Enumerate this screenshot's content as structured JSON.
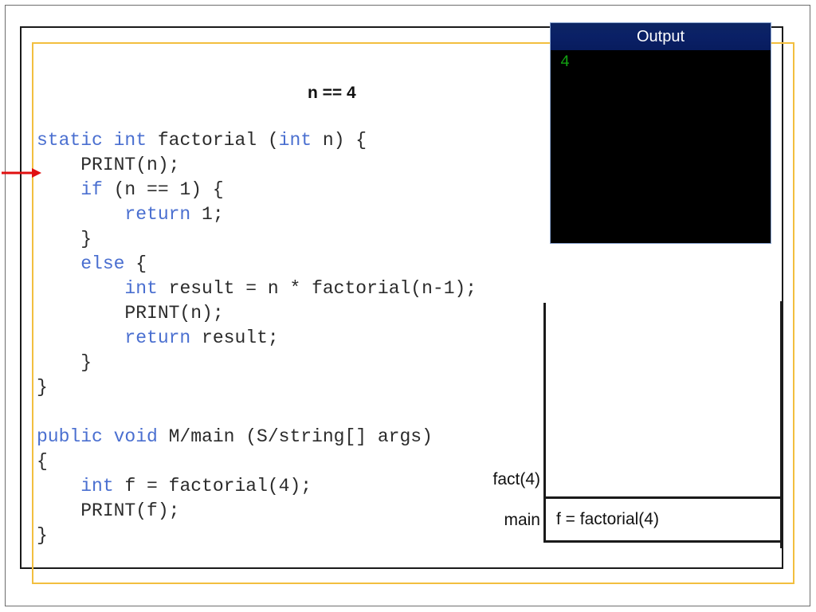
{
  "slide": {
    "title_annotation": "n == 4"
  },
  "code": {
    "lines": [
      [
        {
          "t": "static int",
          "c": "kw"
        },
        {
          "t": " factorial (",
          "c": ""
        },
        {
          "t": "int",
          "c": "kw"
        },
        {
          "t": " n) {",
          "c": ""
        }
      ],
      [
        {
          "t": "    PRINT(n);",
          "c": ""
        }
      ],
      [
        {
          "t": "    ",
          "c": ""
        },
        {
          "t": "if",
          "c": "kw"
        },
        {
          "t": " (n == 1) {",
          "c": ""
        }
      ],
      [
        {
          "t": "        ",
          "c": ""
        },
        {
          "t": "return",
          "c": "kw"
        },
        {
          "t": " 1;",
          "c": ""
        }
      ],
      [
        {
          "t": "    }",
          "c": ""
        }
      ],
      [
        {
          "t": "    ",
          "c": ""
        },
        {
          "t": "else",
          "c": "kw"
        },
        {
          "t": " {",
          "c": ""
        }
      ],
      [
        {
          "t": "        ",
          "c": ""
        },
        {
          "t": "int",
          "c": "kw"
        },
        {
          "t": " result = n * factorial(n-1);",
          "c": ""
        }
      ],
      [
        {
          "t": "        PRINT(n);",
          "c": ""
        }
      ],
      [
        {
          "t": "        ",
          "c": ""
        },
        {
          "t": "return",
          "c": "kw"
        },
        {
          "t": " result;",
          "c": ""
        }
      ],
      [
        {
          "t": "    }",
          "c": ""
        }
      ],
      [
        {
          "t": "}",
          "c": ""
        }
      ],
      [
        {
          "t": "",
          "c": ""
        }
      ],
      [
        {
          "t": "public void",
          "c": "kw"
        },
        {
          "t": " M/main (S/string[] args)",
          "c": ""
        }
      ],
      [
        {
          "t": "{",
          "c": ""
        }
      ],
      [
        {
          "t": "    ",
          "c": ""
        },
        {
          "t": "int",
          "c": "kw"
        },
        {
          "t": " f = factorial(4);",
          "c": ""
        }
      ],
      [
        {
          "t": "    PRINT(f);",
          "c": ""
        }
      ],
      [
        {
          "t": "}",
          "c": ""
        }
      ]
    ]
  },
  "output_window": {
    "title": "Output",
    "lines": [
      "4"
    ],
    "title_bar_color": "#0a2066",
    "body_color": "#000000",
    "text_color": "#12a012"
  },
  "call_stack": {
    "frames": [
      {
        "label": "fact(4)",
        "content": ""
      },
      {
        "label": "main",
        "content": "f = factorial(4)"
      }
    ]
  },
  "pointer": {
    "name": "execution-pointer",
    "color": "#e01010",
    "points_at_line": "if (n == 1) {"
  },
  "colors": {
    "keyword": "#4a6fd0",
    "code_text": "#2b2b2b",
    "highlight_border": "#f2bf3f",
    "content_border": "#1a1a1a"
  }
}
